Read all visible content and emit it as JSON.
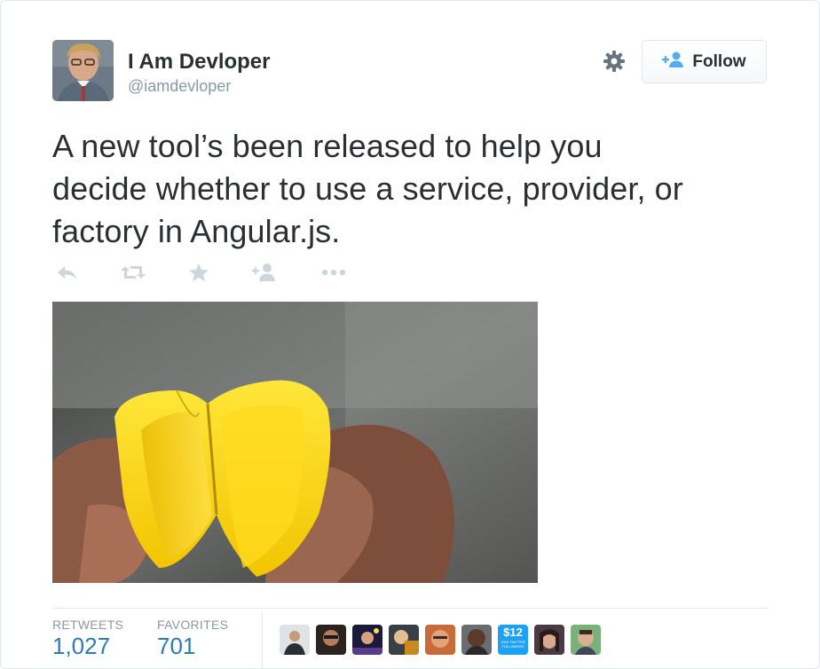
{
  "user": {
    "name": "I Am Devloper",
    "handle": "@iamdevloper"
  },
  "follow_button": {
    "label": "Follow",
    "accent": "#55acee"
  },
  "tweet": {
    "lines": [
      "A new tool’s been released to help you",
      "decide whether to use a service, provider, or",
      "factory in Angular.js."
    ]
  },
  "actions": [
    {
      "icon": "reply-icon"
    },
    {
      "icon": "retweet-icon"
    },
    {
      "icon": "favorite-star-icon"
    },
    {
      "icon": "follow-user-icon"
    },
    {
      "icon": "more-dots-icon"
    }
  ],
  "media": {
    "subject": "yellow paper fortune teller held in hands"
  },
  "stats": {
    "retweets_label": "RETWEETS",
    "retweets_value": "1,027",
    "favorites_label": "FAVORITES",
    "favorites_value": "701"
  },
  "favoriters": {
    "count": 9,
    "promo_badge": {
      "price": "$12",
      "caption": "1000 TWITTER FOLLOWERS"
    }
  },
  "colors": {
    "text": "#292f33",
    "muted": "#8899a6",
    "link": "#2b7bb9",
    "border": "#e1e8ed",
    "icon": "#ccd6dd"
  }
}
